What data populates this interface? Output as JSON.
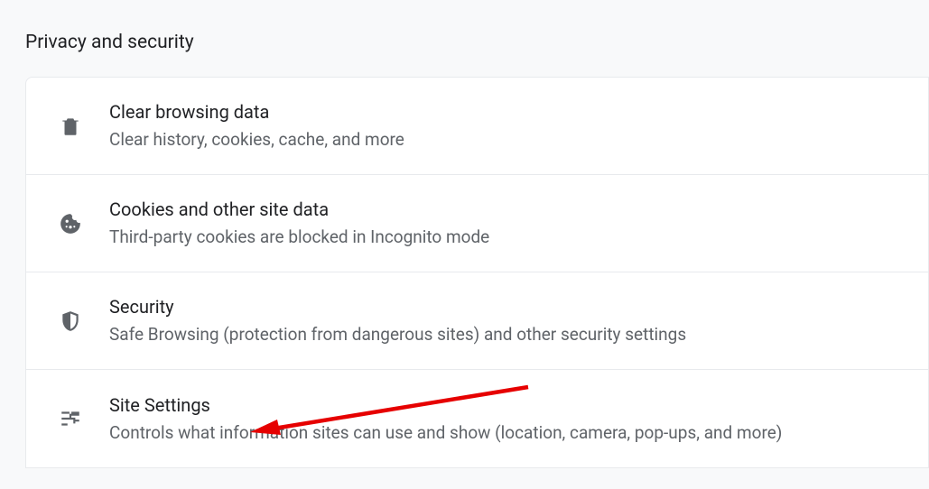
{
  "header": {
    "title": "Privacy and security"
  },
  "rows": [
    {
      "icon": "trash-icon",
      "title": "Clear browsing data",
      "subtitle": "Clear history, cookies, cache, and more"
    },
    {
      "icon": "cookie-icon",
      "title": "Cookies and other site data",
      "subtitle": "Third-party cookies are blocked in Incognito mode"
    },
    {
      "icon": "shield-icon",
      "title": "Security",
      "subtitle": "Safe Browsing (protection from dangerous sites) and other security settings"
    },
    {
      "icon": "tune-icon",
      "title": "Site Settings",
      "subtitle": "Controls what information sites can use and show (location, camera, pop-ups, and more)"
    }
  ],
  "annotation": {
    "color": "#e60000"
  }
}
